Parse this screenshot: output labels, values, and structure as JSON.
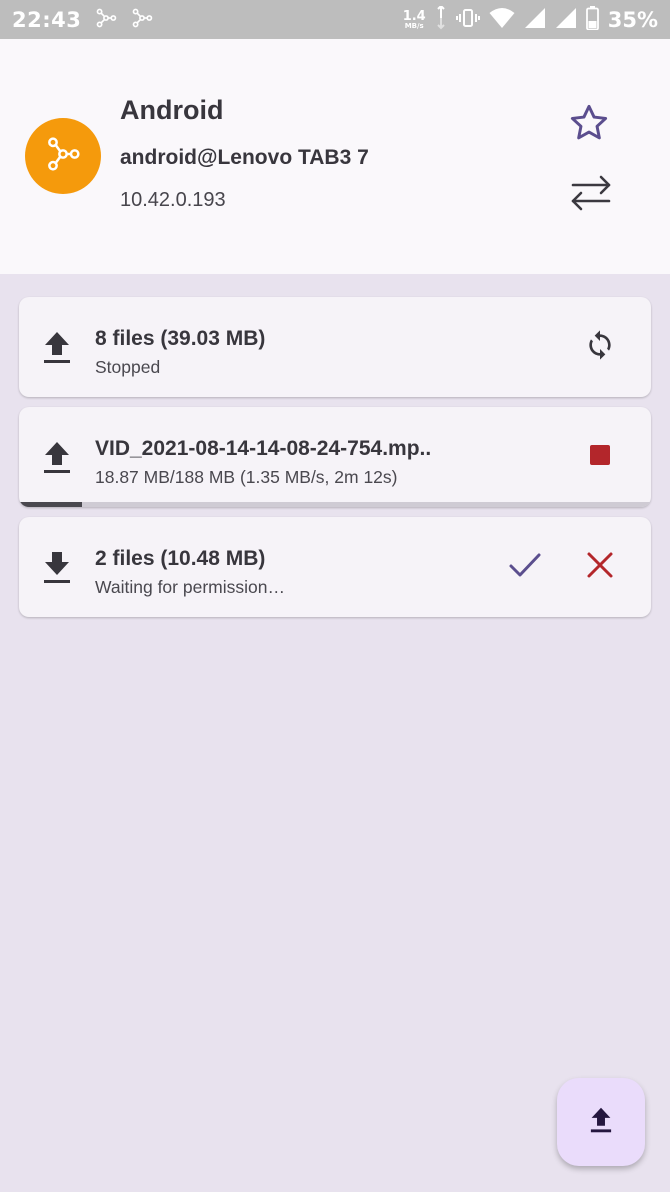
{
  "status_bar": {
    "time": "22:43",
    "net_speed_value": "1.4",
    "net_speed_unit": "MB/s",
    "battery": "35%",
    "icons": [
      "share-hub-icon",
      "share-hub-icon",
      "vibrate-icon",
      "wifi-icon",
      "signal-icon",
      "signal-icon",
      "battery-icon"
    ]
  },
  "device": {
    "name": "Android",
    "user": "android@Lenovo TAB3 7",
    "ip": "10.42.0.193",
    "avatar_color": "#f59a0c",
    "accent_color": "#5b4e8e"
  },
  "transfers": [
    {
      "direction": "upload",
      "title": "8 files (39.03 MB)",
      "status": "Stopped",
      "actions": [
        "retry-icon"
      ]
    },
    {
      "direction": "upload",
      "title": "VID_2021-08-14-14-08-24-754.mp..",
      "status": "18.87 MB/188 MB (1.35 MB/s, 2m 12s)",
      "progress_fraction": 0.1,
      "actions": [
        "stop-icon"
      ]
    },
    {
      "direction": "download",
      "title": "2 files (10.48 MB)",
      "status": "Waiting for permission…",
      "actions": [
        "accept-check-icon",
        "reject-x-icon"
      ]
    }
  ],
  "colors": {
    "stop": "#b3262b",
    "reject": "#b3262b",
    "accept": "#5b4e8e",
    "fab_bg": "#eadcfb"
  }
}
